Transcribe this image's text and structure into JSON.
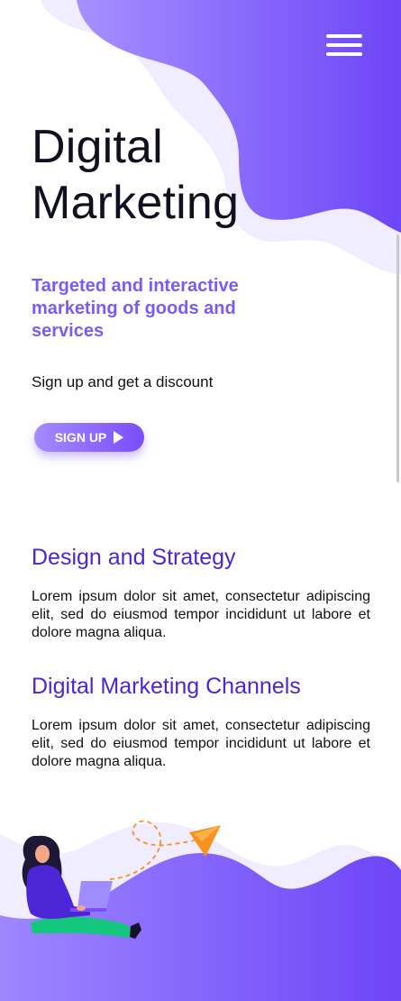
{
  "header": {
    "menu_icon": "hamburger-menu-icon"
  },
  "hero": {
    "title_line1": "Digital",
    "title_line2": "Marketing",
    "subtitle": "Targeted and interactive marketing of goods and services",
    "cta_text": "Sign up and get a discount",
    "signup_label": "SIGN UP",
    "signup_icon": "play-icon"
  },
  "sections": [
    {
      "title": "Design and Strategy",
      "text": "Lorem ipsum dolor sit amet, consectetur adipiscing elit, sed do eiusmod tempor incididunt ut labore et dolore magna aliqua."
    },
    {
      "title": "Digital Marketing Channels",
      "text": "Lorem ipsum dolor sit amet, consectetur adipiscing elit, sed do eiusmod tempor incididunt ut labore et dolore magna aliqua."
    }
  ],
  "colors": {
    "accent": "#7b4dff",
    "heading": "#4b25d6",
    "subtitle": "#7a5af8",
    "blob_light": "#efedff",
    "plane": "#f7931e"
  }
}
